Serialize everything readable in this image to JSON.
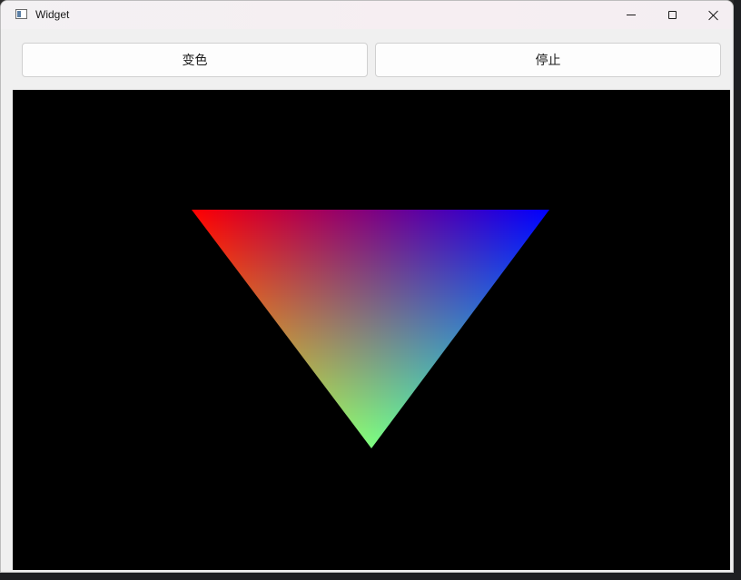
{
  "window": {
    "title": "Widget",
    "icon": "app-window-icon"
  },
  "titlebar_controls": {
    "minimize_icon": "minimize-icon",
    "maximize_icon": "maximize-icon",
    "close_icon": "close-icon"
  },
  "toolbar": {
    "change_color_label": "变色",
    "stop_label": "停止"
  },
  "gl_view": {
    "background": "#000000",
    "triangle": {
      "vertex_colors": {
        "top_left": "#ff0000",
        "top_right": "#0000ff",
        "bottom": "#00ff00"
      }
    }
  }
}
